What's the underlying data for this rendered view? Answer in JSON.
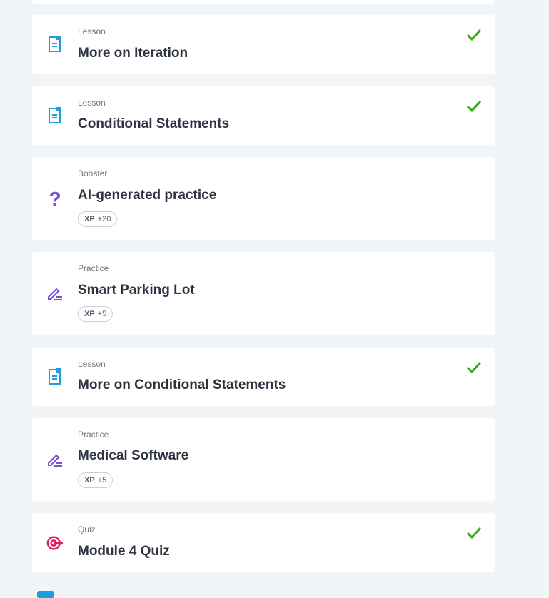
{
  "items": [
    {
      "kind": "Lesson",
      "title": "More on Iteration",
      "icon": "lesson-document-icon",
      "completed": true
    },
    {
      "kind": "Lesson",
      "title": "Conditional Statements",
      "icon": "lesson-document-icon",
      "completed": true
    },
    {
      "kind": "Booster",
      "title": "AI-generated practice",
      "icon": "question-mark-icon",
      "xp_label": "XP",
      "xp_value": "+20"
    },
    {
      "kind": "Practice",
      "title": "Smart Parking Lot",
      "icon": "pencil-edit-icon",
      "xp_label": "XP",
      "xp_value": "+5"
    },
    {
      "kind": "Lesson",
      "title": "More on Conditional Statements",
      "icon": "lesson-document-icon",
      "completed": true
    },
    {
      "kind": "Practice",
      "title": "Medical Software",
      "icon": "pencil-edit-icon",
      "xp_label": "XP",
      "xp_value": "+5"
    },
    {
      "kind": "Quiz",
      "title": "Module 4 Quiz",
      "icon": "target-icon",
      "completed": true
    }
  ],
  "colors": {
    "lesson_icon": "#1f9fd6",
    "practice_icon": "#7b4fd1",
    "quiz_icon": "#e0195f",
    "check": "#3aa61b"
  }
}
